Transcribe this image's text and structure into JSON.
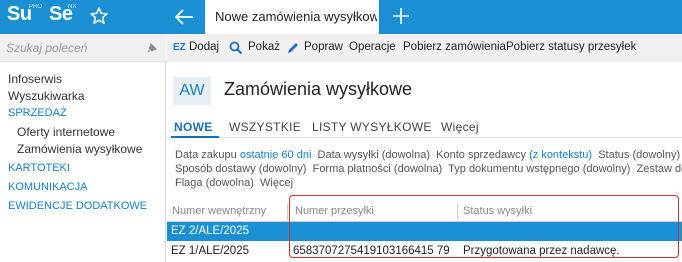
{
  "topbar": {
    "logo1": {
      "text": "Su",
      "sup": "PRO"
    },
    "logo2": {
      "text": "Se",
      "sup": "NX"
    },
    "tab_title": "Nowe zamówienia wysyłkowe",
    "icons": [
      "star-icon",
      "back-arrow-icon",
      "plus-icon"
    ]
  },
  "sidebar": {
    "search_placeholder": "Szukaj poleceń",
    "items": [
      {
        "label": "Infoserwis",
        "kind": "plain"
      },
      {
        "label": "Wyszukiwarka",
        "kind": "plain"
      },
      {
        "label": "SPRZEDAŻ",
        "kind": "section"
      },
      {
        "label": "Oferty internetowe",
        "kind": "sub"
      },
      {
        "label": "Zamówienia wysyłkowe",
        "kind": "sub"
      },
      {
        "label": "KARTOTEKI",
        "kind": "section"
      },
      {
        "label": "KOMUNIKACJA",
        "kind": "section"
      },
      {
        "label": "EWIDENCJE DODATKOWE",
        "kind": "section"
      }
    ]
  },
  "toolbar": {
    "ez": "EZ",
    "add": "Dodaj",
    "show": "Pokaż",
    "edit": "Popraw",
    "operations": "Operacje",
    "fetch_orders": "Pobierz zamówienia",
    "fetch_status": "Pobierz statusy przesyłek"
  },
  "header": {
    "badge": "AW",
    "title": "Zamówienia wysyłkowe"
  },
  "tabs": [
    "NOWE",
    "WSZYSTKIE",
    "LISTY WYSYŁKOWE",
    "Więcej"
  ],
  "filters": {
    "line1": [
      {
        "label": "Data zakupu",
        "value": "ostatnie 60 dni"
      },
      {
        "label": "Data wysyłki",
        "value": "(dowolna)"
      },
      {
        "label": "Konto sprzedawcy",
        "value": "(z kontekstu)"
      },
      {
        "label": "Status",
        "value": "(dowolny)"
      },
      {
        "label": "Ce",
        "value": ""
      }
    ],
    "line2": [
      {
        "label": "Sposób dostawy",
        "value": "(dowolny)"
      },
      {
        "label": "Forma płatności",
        "value": "(dowolna)"
      },
      {
        "label": "Typ dokumentu wstępnego",
        "value": "(dowolny)"
      },
      {
        "label": "Zestaw doku",
        "value": ""
      }
    ],
    "line3": [
      {
        "label": "Flaga",
        "value": "(dowolna)"
      },
      {
        "label": "Więcej",
        "value": ""
      }
    ]
  },
  "grid": {
    "columns": [
      "Numer wewnętrzny",
      "Numer przesyłki",
      "Status wysyłki"
    ],
    "rows": [
      {
        "number": "EZ 2/ALE/2025",
        "tracking": "",
        "status": ""
      },
      {
        "number": "EZ 1/ALE/2025",
        "tracking": "6583707275419103166415 79",
        "status": "Przygotowana przez nadawcę."
      }
    ]
  },
  "colors": {
    "accent": "#1a8fd3",
    "highlight": "#d9302c"
  }
}
